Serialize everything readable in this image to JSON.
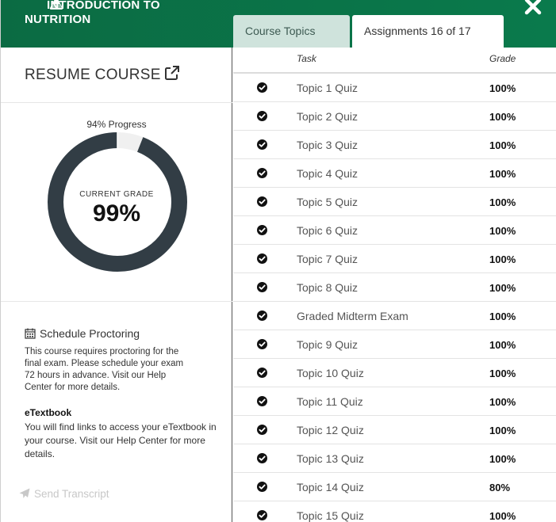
{
  "header": {
    "title_line1": "INTRODUCTION TO",
    "title_line2": "NUTRITION",
    "tabs": [
      {
        "label": "Course Topics"
      },
      {
        "label": "Assignments 16 of 17"
      }
    ],
    "accent": "#0b6b43"
  },
  "left": {
    "resume_label": "RESUME COURSE",
    "progress_label": "94% Progress",
    "progress_value": 0.94,
    "grade_caption": "CURRENT GRADE",
    "grade_value": "99%",
    "donut_color": "#323d45",
    "proctoring": {
      "heading": "Schedule Proctoring",
      "text": "This course requires proctoring for the final exam. Please schedule your exam 72 hours in advance. Visit our Help Center for more details."
    },
    "etextbook": {
      "heading": "eTextbook",
      "text_before": "You will find links to access your eTextbook in your course. Visit our ",
      "link": "Help Center",
      "text_after": " for more details."
    },
    "send_transcript": "Send Transcript"
  },
  "table": {
    "col_task": "Task",
    "col_grade": "Grade",
    "rows": [
      {
        "task": "Topic 1 Quiz",
        "grade": "100%"
      },
      {
        "task": "Topic 2 Quiz",
        "grade": "100%"
      },
      {
        "task": "Topic 3 Quiz",
        "grade": "100%"
      },
      {
        "task": "Topic 4 Quiz",
        "grade": "100%"
      },
      {
        "task": "Topic 5 Quiz",
        "grade": "100%"
      },
      {
        "task": "Topic 6 Quiz",
        "grade": "100%"
      },
      {
        "task": "Topic 7 Quiz",
        "grade": "100%"
      },
      {
        "task": "Topic 8 Quiz",
        "grade": "100%"
      },
      {
        "task": "Graded Midterm Exam",
        "grade": "100%"
      },
      {
        "task": "Topic 9 Quiz",
        "grade": "100%"
      },
      {
        "task": "Topic 10 Quiz",
        "grade": "100%"
      },
      {
        "task": "Topic 11 Quiz",
        "grade": "100%"
      },
      {
        "task": "Topic 12 Quiz",
        "grade": "100%"
      },
      {
        "task": "Topic 13 Quiz",
        "grade": "100%"
      },
      {
        "task": "Topic 14 Quiz",
        "grade": "80%"
      },
      {
        "task": "Topic 15 Quiz",
        "grade": "100%"
      }
    ]
  }
}
